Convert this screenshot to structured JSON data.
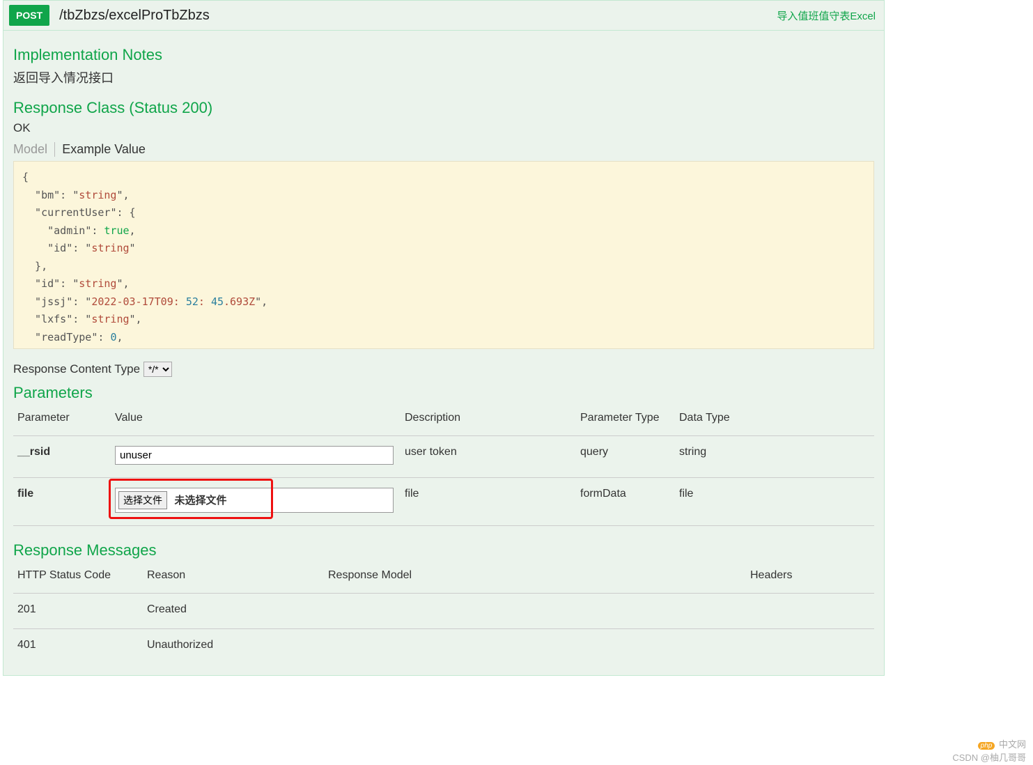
{
  "header": {
    "method": "POST",
    "path": "/tbZbzs/excelProTbZbzs",
    "summary_link": "导入值班值守表Excel"
  },
  "notes": {
    "title": "Implementation Notes",
    "description": "返回导入情况接口"
  },
  "response_class": {
    "title": "Response Class (Status 200)",
    "status_text": "OK",
    "tabs": {
      "model": "Model",
      "example": "Example Value"
    }
  },
  "example_json_tokens": [
    [
      "p",
      "{"
    ],
    [
      "p",
      "  \""
    ],
    [
      "k",
      "bm"
    ],
    [
      "p",
      "\": \""
    ],
    [
      "s",
      "string"
    ],
    [
      "p",
      "\","
    ],
    [
      "p",
      "  \""
    ],
    [
      "k",
      "currentUser"
    ],
    [
      "p",
      "\": {"
    ],
    [
      "p",
      "    \""
    ],
    [
      "k",
      "admin"
    ],
    [
      "p",
      "\": "
    ],
    [
      "b",
      "true"
    ],
    [
      "p",
      ","
    ],
    [
      "p",
      "    \""
    ],
    [
      "k",
      "id"
    ],
    [
      "p",
      "\": \""
    ],
    [
      "s",
      "string"
    ],
    [
      "p",
      "\""
    ],
    [
      "p",
      "  },"
    ],
    [
      "p",
      "  \""
    ],
    [
      "k",
      "id"
    ],
    [
      "p",
      "\": \""
    ],
    [
      "s",
      "string"
    ],
    [
      "p",
      "\","
    ],
    [
      "p",
      "  \""
    ],
    [
      "k",
      "jssj"
    ],
    [
      "p",
      "\": \""
    ],
    [
      "s",
      "2022-03-17T09:52:45.693Z"
    ],
    [
      "p",
      "\","
    ],
    [
      "p",
      "  \""
    ],
    [
      "k",
      "lxfs"
    ],
    [
      "p",
      "\": \""
    ],
    [
      "s",
      "string"
    ],
    [
      "p",
      "\","
    ],
    [
      "p",
      "  \""
    ],
    [
      "k",
      "readType"
    ],
    [
      "p",
      "\": "
    ],
    [
      "n",
      "0"
    ],
    [
      "p",
      ","
    ]
  ],
  "example_lines": [
    "{",
    "  \"bm\": \"string\",",
    "  \"currentUser\": {",
    "    \"admin\": true,",
    "    \"id\": \"string\"",
    "  },",
    "  \"id\": \"string\",",
    "  \"jssj\": \"2022-03-17T09:52:45.693Z\",",
    "  \"lxfs\": \"string\",",
    "  \"readType\": 0,"
  ],
  "content_type": {
    "label": "Response Content Type",
    "selected": "*/*"
  },
  "parameters": {
    "title": "Parameters",
    "columns": {
      "parameter": "Parameter",
      "value": "Value",
      "description": "Description",
      "param_type": "Parameter Type",
      "data_type": "Data Type"
    },
    "rows": [
      {
        "name": "__rsid",
        "value": "unuser",
        "description": "user token",
        "param_type": "query",
        "data_type": "string",
        "input_kind": "text"
      },
      {
        "name": "file",
        "file_button": "选择文件",
        "file_status": "未选择文件",
        "description": "file",
        "param_type": "formData",
        "data_type": "file",
        "input_kind": "file"
      }
    ]
  },
  "responses": {
    "title": "Response Messages",
    "columns": {
      "code": "HTTP Status Code",
      "reason": "Reason",
      "model": "Response Model",
      "headers": "Headers"
    },
    "rows": [
      {
        "code": "201",
        "reason": "Created"
      },
      {
        "code": "401",
        "reason": "Unauthorized"
      }
    ]
  },
  "watermarks": {
    "php_badge": "php",
    "php_text": "中文网",
    "csdn": "CSDN @柚几哥哥"
  }
}
